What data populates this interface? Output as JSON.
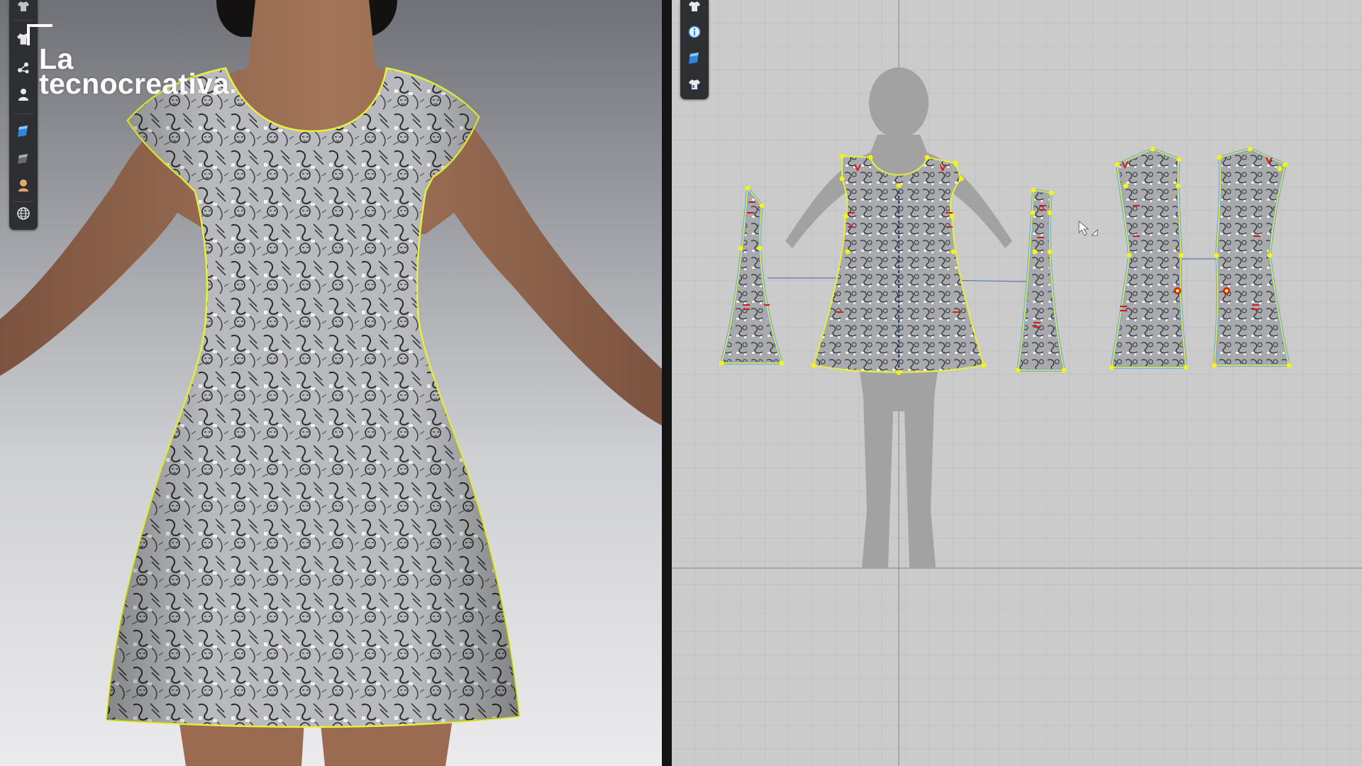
{
  "brand": {
    "line1": "La",
    "line2": "tecnocreativa"
  },
  "toolbar_3d": {
    "tools": [
      {
        "icon": "garment-top-icon"
      },
      {
        "icon": "tshirt-icon"
      },
      {
        "icon": "nodes-icon"
      },
      {
        "icon": "avatar-icon"
      },
      {
        "icon": "blue-fabric-icon"
      },
      {
        "icon": "grey-fabric-icon"
      },
      {
        "icon": "avatar-skin-icon"
      },
      {
        "icon": "globe-icon"
      }
    ]
  },
  "toolbar_2d": {
    "tools": [
      {
        "icon": "tshirt-icon"
      },
      {
        "icon": "info-icon"
      },
      {
        "icon": "blue-fabric-icon"
      },
      {
        "icon": "tshirt-outline-icon"
      }
    ]
  },
  "colors": {
    "seam_outline": "#e8f13a",
    "pattern_edge": "#7aa6d6",
    "notch": "#d11a1a",
    "point": "#f2f21c",
    "fabric_base": "#b9babd",
    "skin": "#9a6b50",
    "grid_bg": "#cbcbcb"
  },
  "pattern_pieces": [
    {
      "name": "left-sleeve-side-panel"
    },
    {
      "name": "front-panel"
    },
    {
      "name": "right-side-panel"
    },
    {
      "name": "back-panel-left"
    },
    {
      "name": "back-panel-right"
    }
  ]
}
